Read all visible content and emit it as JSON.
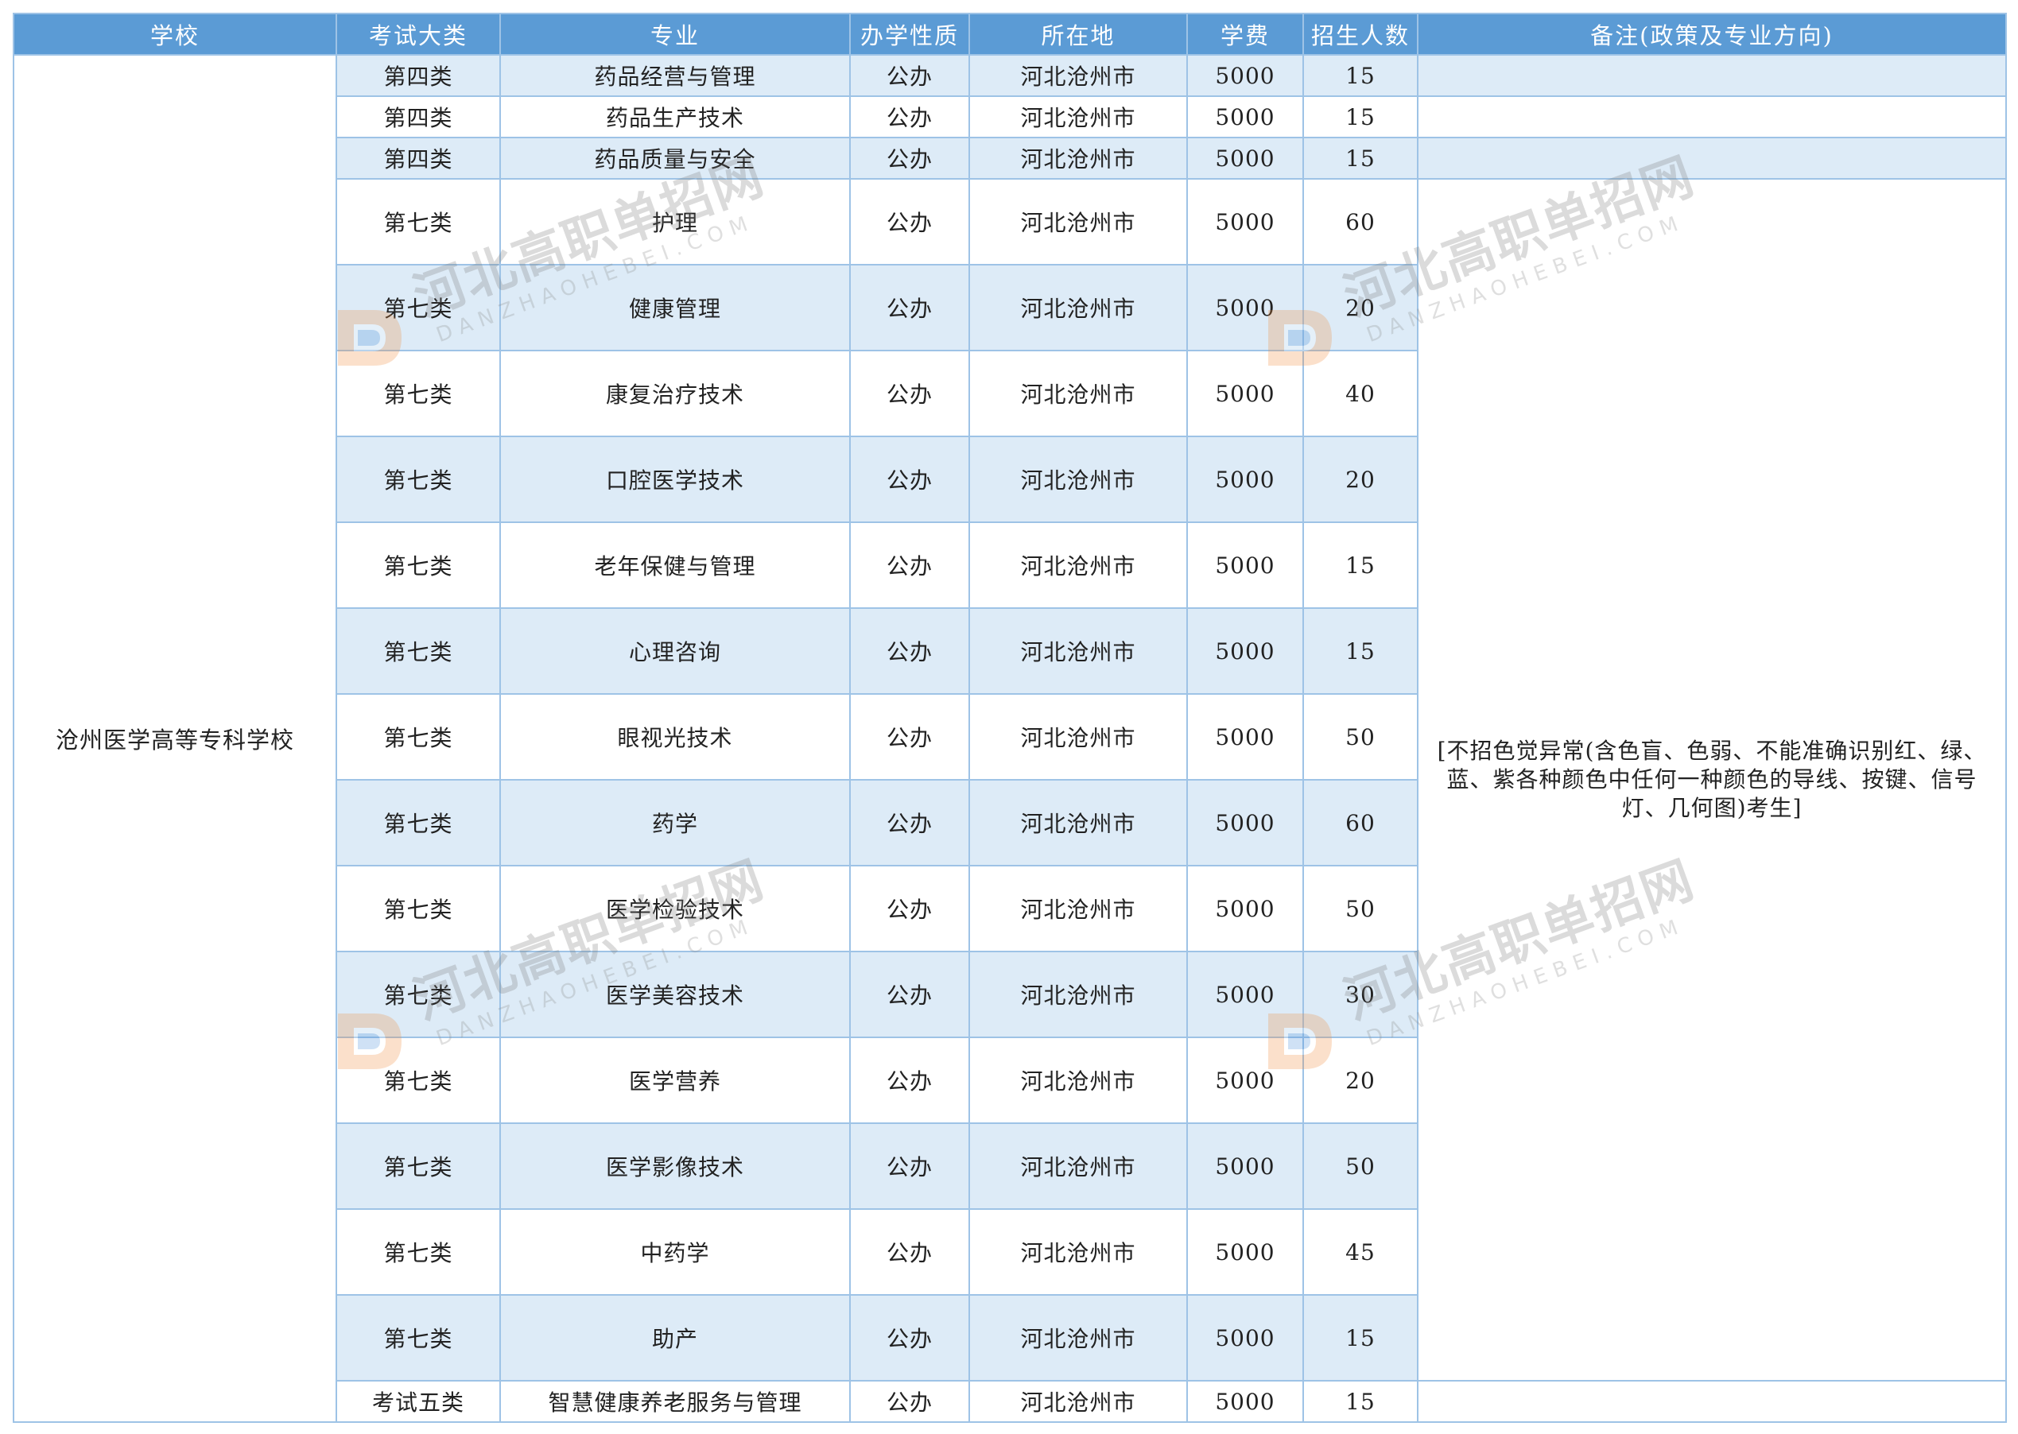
{
  "headers": [
    "学校",
    "考试大类",
    "专业",
    "办学性质",
    "所在地",
    "学费",
    "招生人数",
    "备注(政策及专业方向)"
  ],
  "school": "沧州医学高等专科学校",
  "note": "[不招色觉异常(含色盲、色弱、不能准确识别红、绿、蓝、紫各种颜色中任何一种颜色的导线、按键、信号灯、几何图)考生]",
  "rows": [
    {
      "category": "第四类",
      "major": "药品经营与管理",
      "nature": "公办",
      "location": "河北沧州市",
      "tuition": "5000",
      "quota": "15"
    },
    {
      "category": "第四类",
      "major": "药品生产技术",
      "nature": "公办",
      "location": "河北沧州市",
      "tuition": "5000",
      "quota": "15"
    },
    {
      "category": "第四类",
      "major": "药品质量与安全",
      "nature": "公办",
      "location": "河北沧州市",
      "tuition": "5000",
      "quota": "15"
    },
    {
      "category": "第七类",
      "major": "护理",
      "nature": "公办",
      "location": "河北沧州市",
      "tuition": "5000",
      "quota": "60"
    },
    {
      "category": "第七类",
      "major": "健康管理",
      "nature": "公办",
      "location": "河北沧州市",
      "tuition": "5000",
      "quota": "20"
    },
    {
      "category": "第七类",
      "major": "康复治疗技术",
      "nature": "公办",
      "location": "河北沧州市",
      "tuition": "5000",
      "quota": "40"
    },
    {
      "category": "第七类",
      "major": "口腔医学技术",
      "nature": "公办",
      "location": "河北沧州市",
      "tuition": "5000",
      "quota": "20"
    },
    {
      "category": "第七类",
      "major": "老年保健与管理",
      "nature": "公办",
      "location": "河北沧州市",
      "tuition": "5000",
      "quota": "15"
    },
    {
      "category": "第七类",
      "major": "心理咨询",
      "nature": "公办",
      "location": "河北沧州市",
      "tuition": "5000",
      "quota": "15"
    },
    {
      "category": "第七类",
      "major": "眼视光技术",
      "nature": "公办",
      "location": "河北沧州市",
      "tuition": "5000",
      "quota": "50"
    },
    {
      "category": "第七类",
      "major": "药学",
      "nature": "公办",
      "location": "河北沧州市",
      "tuition": "5000",
      "quota": "60"
    },
    {
      "category": "第七类",
      "major": "医学检验技术",
      "nature": "公办",
      "location": "河北沧州市",
      "tuition": "5000",
      "quota": "50"
    },
    {
      "category": "第七类",
      "major": "医学美容技术",
      "nature": "公办",
      "location": "河北沧州市",
      "tuition": "5000",
      "quota": "30"
    },
    {
      "category": "第七类",
      "major": "医学营养",
      "nature": "公办",
      "location": "河北沧州市",
      "tuition": "5000",
      "quota": "20"
    },
    {
      "category": "第七类",
      "major": "医学影像技术",
      "nature": "公办",
      "location": "河北沧州市",
      "tuition": "5000",
      "quota": "50"
    },
    {
      "category": "第七类",
      "major": "中药学",
      "nature": "公办",
      "location": "河北沧州市",
      "tuition": "5000",
      "quota": "45"
    },
    {
      "category": "第七类",
      "major": "助产",
      "nature": "公办",
      "location": "河北沧州市",
      "tuition": "5000",
      "quota": "15"
    },
    {
      "category": "考试五类",
      "major": "智慧健康养老服务与管理",
      "nature": "公办",
      "location": "河北沧州市",
      "tuition": "5000",
      "quota": "15"
    }
  ],
  "watermark": {
    "cn": "河北高职单招网",
    "en": "DANZHAOHEBEI.COM"
  },
  "colors": {
    "header_bg": "#5b9bd5",
    "header_text": "#ffffff",
    "stripe": "#ddebf7",
    "border": "#9ec3e6",
    "logo_orange": "#f08c3c",
    "logo_blue": "#4a90d9"
  }
}
